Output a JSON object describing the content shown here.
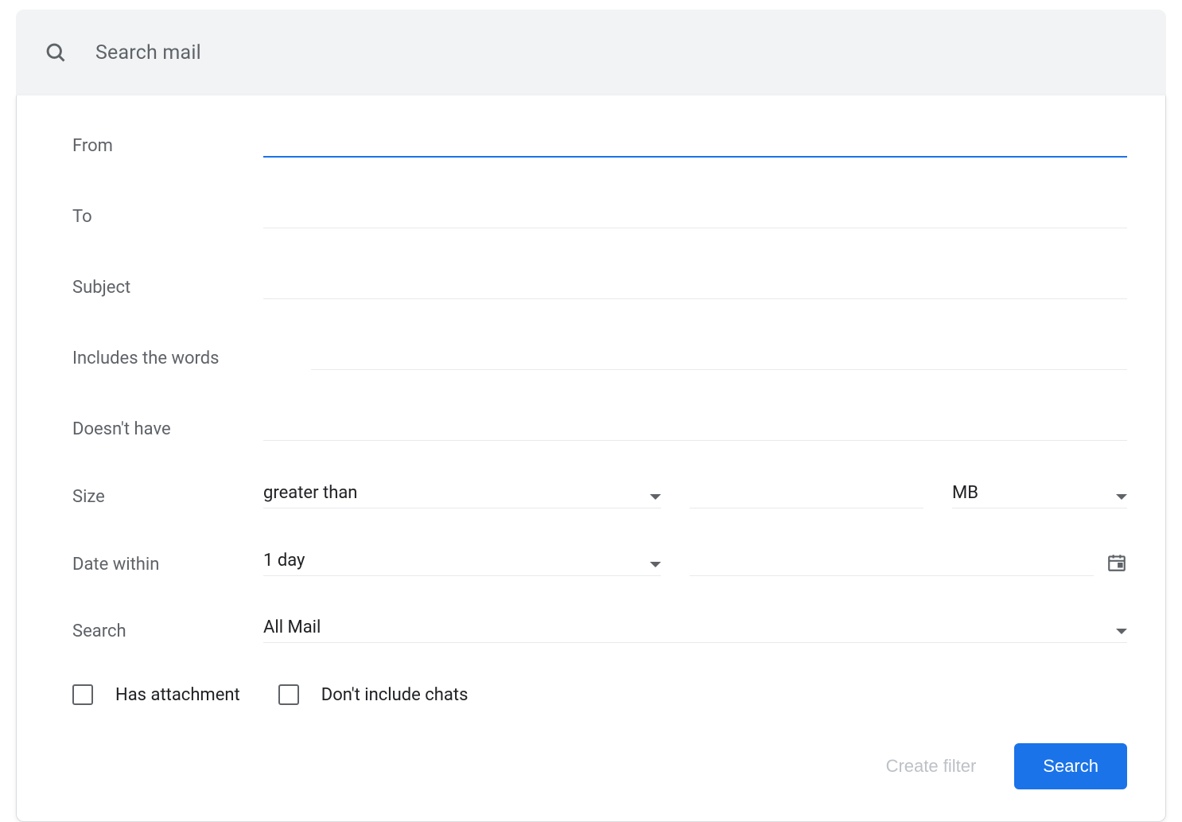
{
  "search": {
    "placeholder": "Search mail"
  },
  "form": {
    "from_label": "From",
    "from_value": "",
    "to_label": "To",
    "to_value": "",
    "subject_label": "Subject",
    "subject_value": "",
    "includes_label": "Includes the words",
    "includes_value": "",
    "doesnt_label": "Doesn't have",
    "doesnt_value": "",
    "size_label": "Size",
    "size_compare": "greater than",
    "size_value": "",
    "size_unit": "MB",
    "date_label": "Date within",
    "date_range": "1 day",
    "date_value": "",
    "search_label": "Search",
    "search_scope": "All Mail",
    "has_attachment_label": "Has attachment",
    "has_attachment_checked": false,
    "exclude_chats_label": "Don't include chats",
    "exclude_chats_checked": false
  },
  "buttons": {
    "create_filter": "Create filter",
    "search": "Search"
  }
}
